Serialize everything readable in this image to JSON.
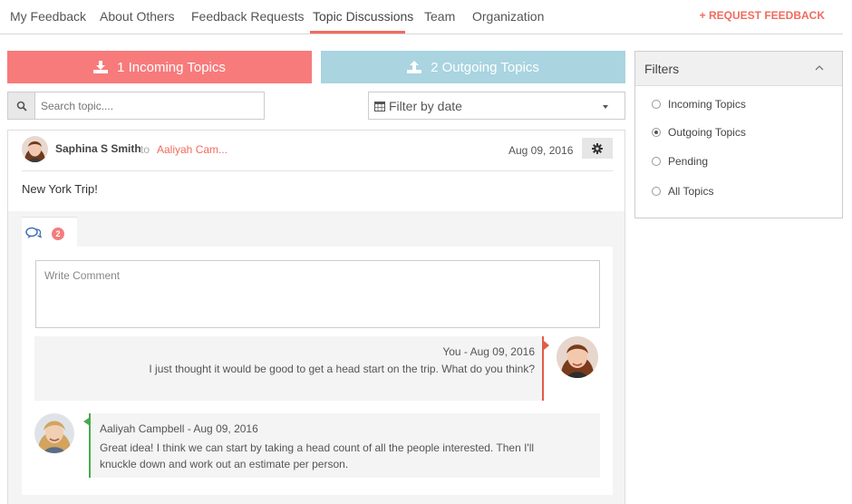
{
  "nav": {
    "items": [
      "My Feedback",
      "About Others",
      "Feedback Requests",
      "Topic Discussions",
      "Team",
      "Organization"
    ],
    "active": "Topic Discussions",
    "request_label": "+ REQUEST FEEDBACK"
  },
  "tabs": {
    "incoming_label": "1 Incoming Topics",
    "outgoing_label": "2 Outgoing Topics"
  },
  "search": {
    "placeholder": "Search topic....",
    "value": ""
  },
  "date_filter": {
    "value": "Filter by date"
  },
  "topic": {
    "sender": "Saphina S Smith",
    "to_label": "to",
    "recipient": "Aaliyah Cam...",
    "date": "Aug 09, 2016",
    "title": "New York Trip!",
    "comment_count": "2"
  },
  "comment_box": {
    "placeholder": "Write Comment"
  },
  "messages": [
    {
      "meta": "You - Aug 09, 2016",
      "text": "I just thought it would be good to get a head start on the  trip. What do you think?"
    },
    {
      "meta": "Aaliyah Campbell - Aug 09, 2016",
      "text": "Great idea! I think we can start by taking a head count of all the people interested. Then I'll knuckle down and work out an estimate per person."
    }
  ],
  "filters": {
    "title": "Filters",
    "options": [
      "Incoming Topics",
      "Outgoing Topics",
      "Pending",
      "All Topics"
    ],
    "selected": "Outgoing Topics"
  },
  "colors": {
    "accent": "#f16b5d",
    "incoming_bg": "#f77b7b",
    "outgoing_bg": "#a9d4e0",
    "you_bar": "#e35a4a",
    "other_bar": "#4aa84e"
  },
  "icons": [
    "download-icon",
    "upload-icon",
    "search-icon",
    "calendar-icon",
    "caret-down-icon",
    "gear-icon",
    "comments-icon",
    "chevron-up-icon"
  ]
}
